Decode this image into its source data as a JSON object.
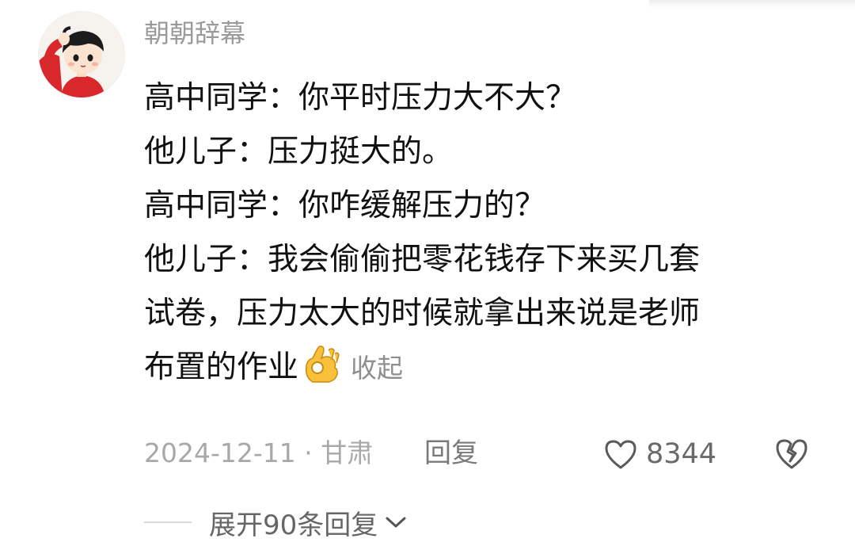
{
  "comment": {
    "username": "朝朝辞幕",
    "lines": [
      "高中同学：你平时压力大不大？",
      "他儿子：压力挺大的。",
      "高中同学：你咋缓解压力的？",
      "他儿子：我会偷偷把零花钱存下来买几套",
      "试卷，压力太大的时候就拿出来说是老师",
      "布置的作业"
    ],
    "emoji": "ok-hand-icon",
    "collapse_label": "收起",
    "date_location": "2024-12-11 · 甘肃",
    "reply_label": "回复",
    "like_count": "8344",
    "expand_label": "展开90条回复"
  }
}
